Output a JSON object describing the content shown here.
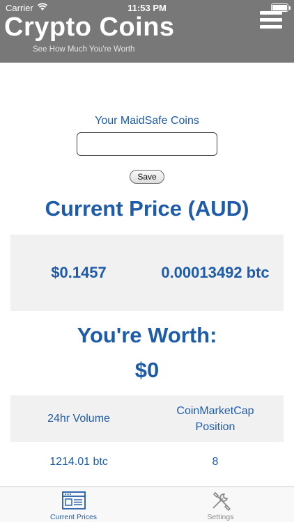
{
  "status_bar": {
    "carrier": "Carrier",
    "time": "11:53 PM",
    "wifi_icon": "wifi-icon",
    "battery_icon": "battery-icon"
  },
  "header": {
    "title": "Crypto Coins",
    "subtitle": "See How Much You're Worth",
    "menu_icon": "hamburger-menu-icon",
    "background_color": "#787878"
  },
  "coins_form": {
    "label": "Your MaidSafe Coins",
    "input_value": "",
    "input_placeholder": "",
    "save_label": "Save"
  },
  "price": {
    "heading": "Current Price (AUD)",
    "aud_value": "$0.1457",
    "btc_value": "0.00013492 btc"
  },
  "worth": {
    "heading": "You're Worth:",
    "value": "$0"
  },
  "stats": {
    "headers": [
      "24hr Volume",
      "CoinMarketCap Position"
    ],
    "values": [
      "1214.01 btc",
      "8"
    ]
  },
  "tabs": [
    {
      "label": "Current Prices",
      "icon": "browser-window-icon",
      "active": true
    },
    {
      "label": "Settings",
      "icon": "wrench-screwdriver-icon",
      "active": false
    }
  ],
  "colors": {
    "accent": "#1e5ba8",
    "panel": "#f1f1f1",
    "inactive_tab": "#8a8a8a"
  }
}
